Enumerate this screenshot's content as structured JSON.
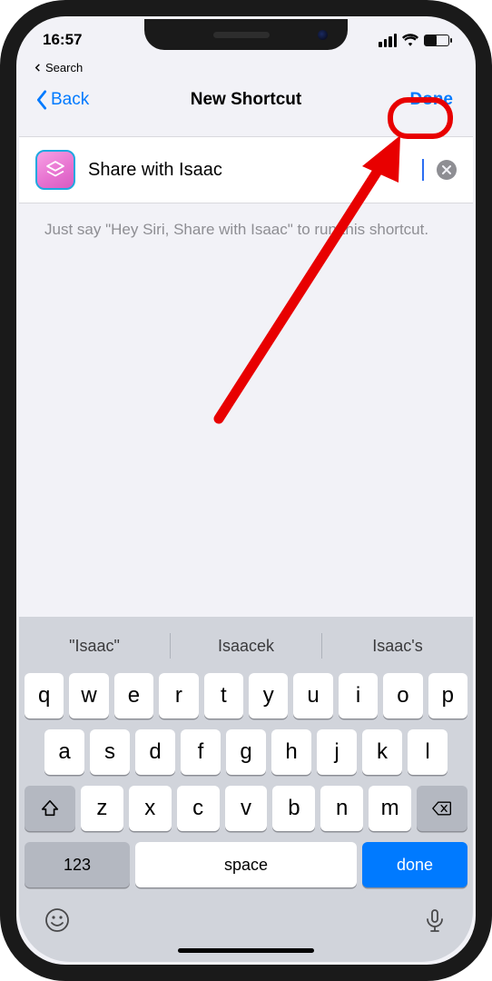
{
  "status": {
    "time": "16:57"
  },
  "breadcrumb": {
    "label": "Search"
  },
  "nav": {
    "back": "Back",
    "title": "New Shortcut",
    "done": "Done"
  },
  "shortcut": {
    "name": "Share with Isaac"
  },
  "hint": "Just say \"Hey Siri, Share with Isaac\" to run this shortcut.",
  "suggestions": [
    "\"Isaac\"",
    "Isaacek",
    "Isaac's"
  ],
  "keys": {
    "row1": [
      "q",
      "w",
      "e",
      "r",
      "t",
      "y",
      "u",
      "i",
      "o",
      "p"
    ],
    "row2": [
      "a",
      "s",
      "d",
      "f",
      "g",
      "h",
      "j",
      "k",
      "l"
    ],
    "row3": [
      "z",
      "x",
      "c",
      "v",
      "b",
      "n",
      "m"
    ],
    "numbers": "123",
    "space": "space",
    "enter": "done"
  }
}
